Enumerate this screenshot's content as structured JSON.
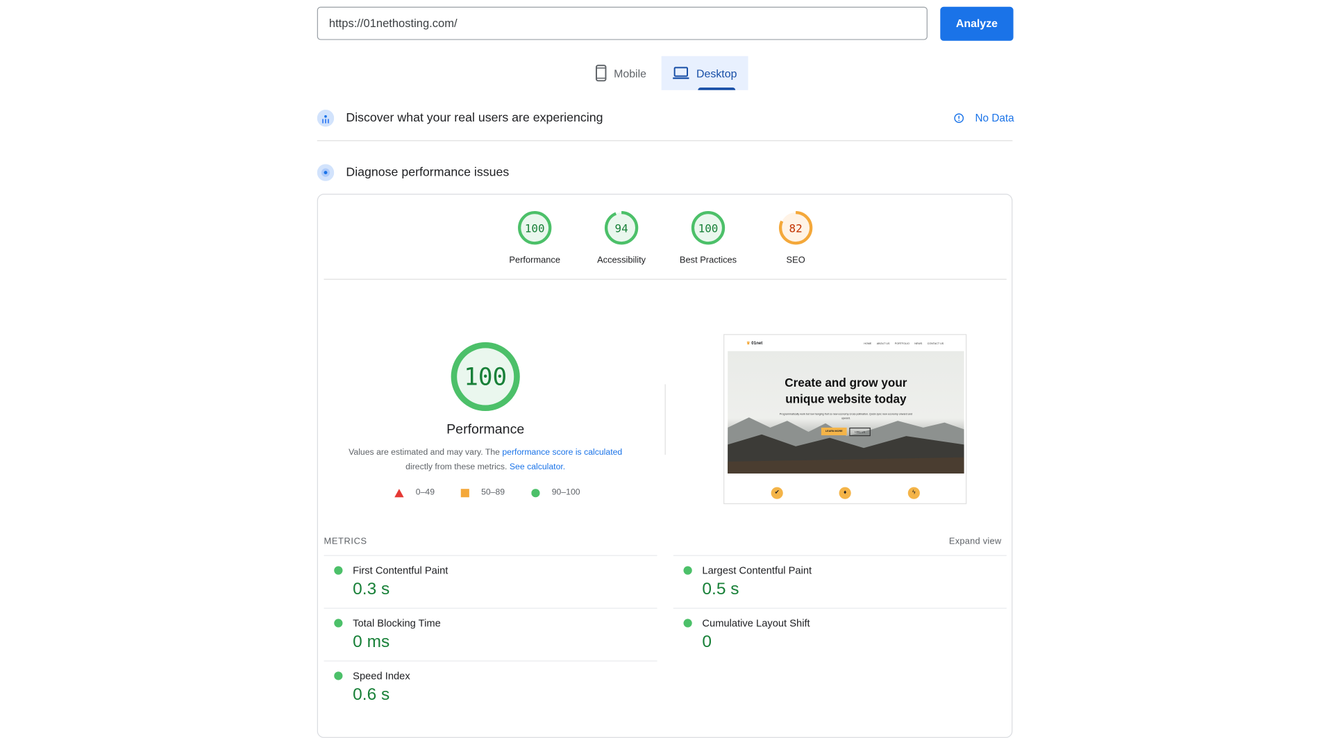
{
  "search": {
    "url": "https://01nethosting.com/",
    "analyze_label": "Analyze"
  },
  "device_tabs": [
    {
      "label": "Mobile",
      "icon": "phone-icon",
      "selected": false
    },
    {
      "label": "Desktop",
      "icon": "laptop-icon",
      "selected": true
    }
  ],
  "field_data": {
    "title": "Discover what your real users are experiencing",
    "status": "No Data"
  },
  "diagnose": {
    "title": "Diagnose performance issues"
  },
  "categories": [
    {
      "label": "Performance",
      "score": 100,
      "status": "pass"
    },
    {
      "label": "Accessibility",
      "score": 94,
      "status": "pass"
    },
    {
      "label": "Best Practices",
      "score": 100,
      "status": "pass"
    },
    {
      "label": "SEO",
      "score": 82,
      "status": "average"
    }
  ],
  "performance": {
    "score": 100,
    "title": "Performance",
    "desc_prefix": "Values are estimated and may vary. The ",
    "desc_link1": "performance score is calculated",
    "desc_middle": " directly from these metrics. ",
    "desc_link2": "See calculator.",
    "legend": [
      {
        "range": "0–49",
        "shape": "triangle",
        "color": "#e53935"
      },
      {
        "range": "50–89",
        "shape": "square",
        "color": "#f4a83a"
      },
      {
        "range": "90–100",
        "shape": "circle",
        "color": "#4cc069"
      }
    ]
  },
  "preview": {
    "logo": "01net",
    "nav": [
      "HOME",
      "ABOUT US",
      "PORTFOLIO",
      "NEWS",
      "CONTACT US"
    ],
    "headline1": "Create and grow your",
    "headline2": "unique website today",
    "sub": "Programmatically work but low hanging fruit so new economy cross-pollination. Quick sync new economy onward and upward.",
    "btn1": "LEARN MORE",
    "btn2": "HIRE US"
  },
  "metrics": {
    "heading": "METRICS",
    "expand_label": "Expand view",
    "items": [
      {
        "label": "First Contentful Paint",
        "value": "0.3 s"
      },
      {
        "label": "Largest Contentful Paint",
        "value": "0.5 s"
      },
      {
        "label": "Total Blocking Time",
        "value": "0 ms"
      },
      {
        "label": "Cumulative Layout Shift",
        "value": "0"
      },
      {
        "label": "Speed Index",
        "value": "0.6 s"
      }
    ]
  },
  "colors": {
    "accent": "#1a73e8",
    "pass": "#0cce6b",
    "pass_text": "#188038",
    "average": "#f4a83a",
    "average_text": "#c33300"
  }
}
